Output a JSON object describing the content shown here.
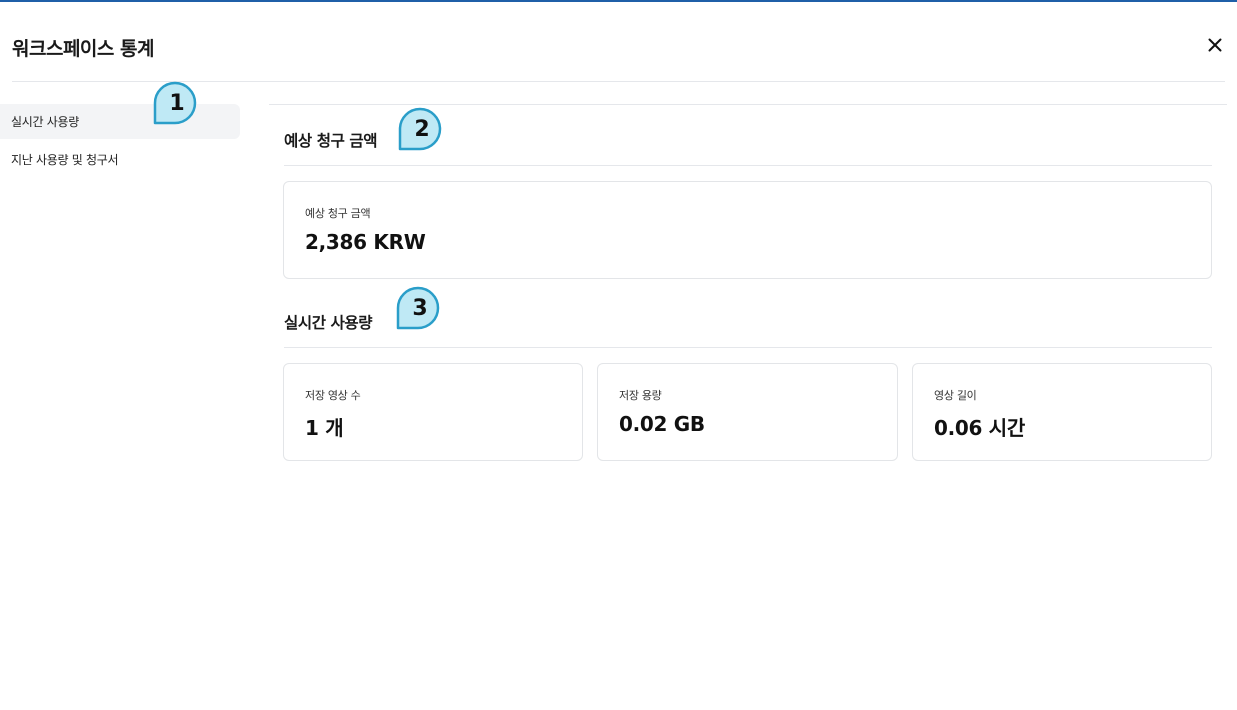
{
  "header": {
    "title": "워크스페이스 통계"
  },
  "sidebar": {
    "items": [
      {
        "label": "실시간 사용량",
        "active": true
      },
      {
        "label": "지난 사용량 및 청구서",
        "active": false
      }
    ]
  },
  "billing": {
    "section_title": "예상 청구 금액",
    "card_label": "예상 청구 금액",
    "card_value": "2,386 KRW"
  },
  "usage": {
    "section_title": "실시간 사용량",
    "cards": [
      {
        "label": "저장 영상 수",
        "value": "1 개"
      },
      {
        "label": "저장 용량",
        "value": "0.02 GB"
      },
      {
        "label": "영상 길이",
        "value": "0.06 시간"
      }
    ]
  },
  "markers": [
    "1",
    "2",
    "3"
  ],
  "colors": {
    "accent": "#1f5fa8",
    "marker_fill": "#bfe9f5",
    "marker_stroke": "#2a9ec9"
  },
  "icons": {
    "close": "close-icon"
  }
}
